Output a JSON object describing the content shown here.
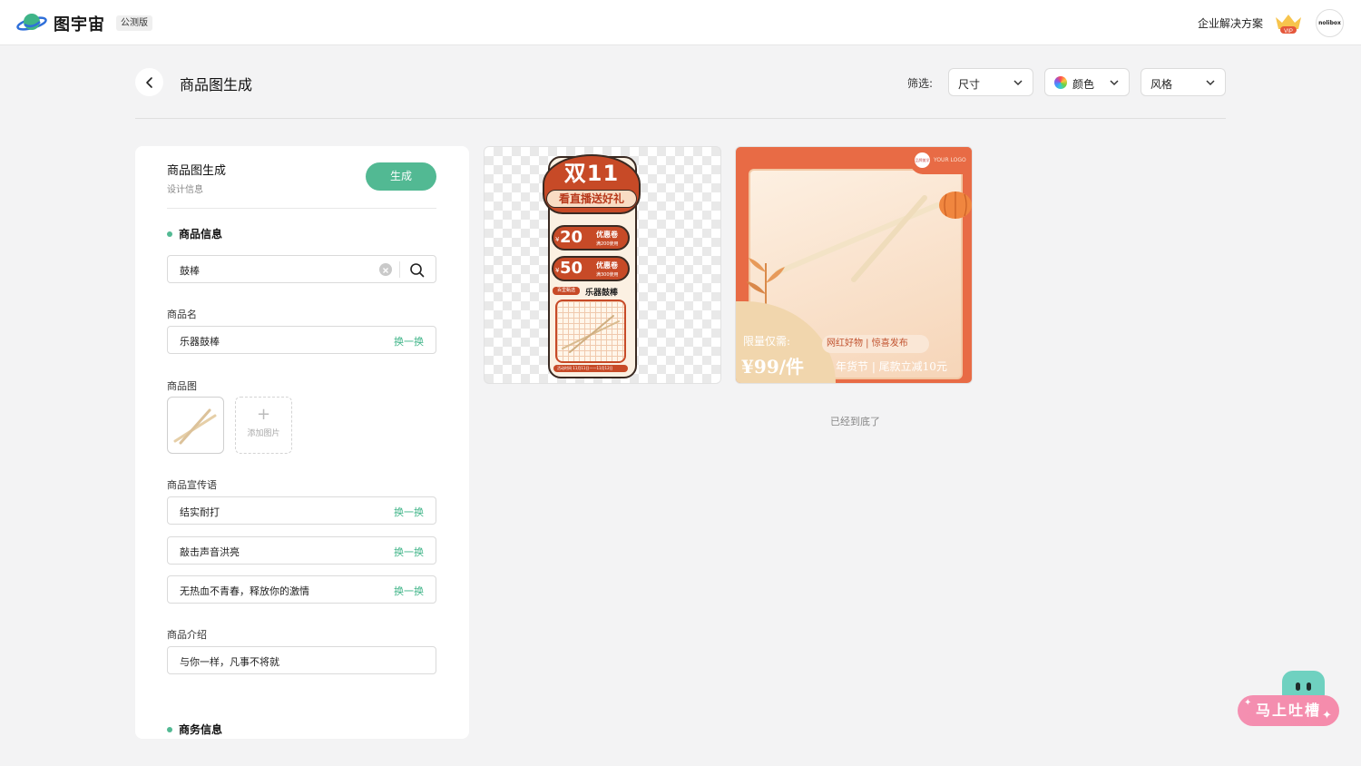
{
  "app": {
    "brand": "图宇宙",
    "beta_badge": "公测版",
    "enterprise_link": "企业解决方案",
    "vip_label": "VIP",
    "avatar_text": "nolibox"
  },
  "header": {
    "title": "商品图生成",
    "filter_label": "筛选:",
    "filters": [
      "尺寸",
      "颜色",
      "风格"
    ]
  },
  "panel": {
    "title": "商品图生成",
    "subtitle": "设计信息",
    "generate_button": "生成",
    "product_info": {
      "heading": "商品信息",
      "search_value": "鼓棒",
      "name_label": "商品名",
      "name_value": "乐器鼓棒",
      "swap_label": "换一换",
      "image_label": "商品图",
      "add_image_label": "添加图片",
      "slogan_label": "商品宣传语",
      "slogans": [
        "结实耐打",
        "敲击声音洪亮",
        "无热血不青春，释放你的激情"
      ],
      "intro_label": "商品介绍",
      "intro_value": "与你一样，凡事不将就"
    },
    "business_info": {
      "heading": "商务信息"
    }
  },
  "results": {
    "poster1": {
      "headline": "双11",
      "subline": "看直播送好礼",
      "currency": "¥",
      "coupons": [
        {
          "amount": "20",
          "tag": "优惠卷",
          "condition": "满200使用"
        },
        {
          "amount": "50",
          "tag": "优惠卷",
          "condition": "满300使用"
        }
      ],
      "tag": "百里甄选",
      "product_name": "乐器鼓棒",
      "footer": "活动时间 11月11日——11月12日"
    },
    "poster2": {
      "logo_mark": "品牌美学",
      "logo_text": "YOUR LOGO",
      "limit_text": "限量仅需:",
      "price": "¥99/件",
      "pill": "网红好物 | 惊喜发布",
      "bottom": "年货节 | 尾款立减10元"
    },
    "end_text": "已经到底了"
  },
  "feedback": {
    "label": "马上吐槽"
  },
  "colors": {
    "accent": "#52b993",
    "swap_link": "#3fb488",
    "poster_orange": "#c74a27",
    "poster2_bg": "#e86b45",
    "feedback_pink": "#f48fb1"
  }
}
